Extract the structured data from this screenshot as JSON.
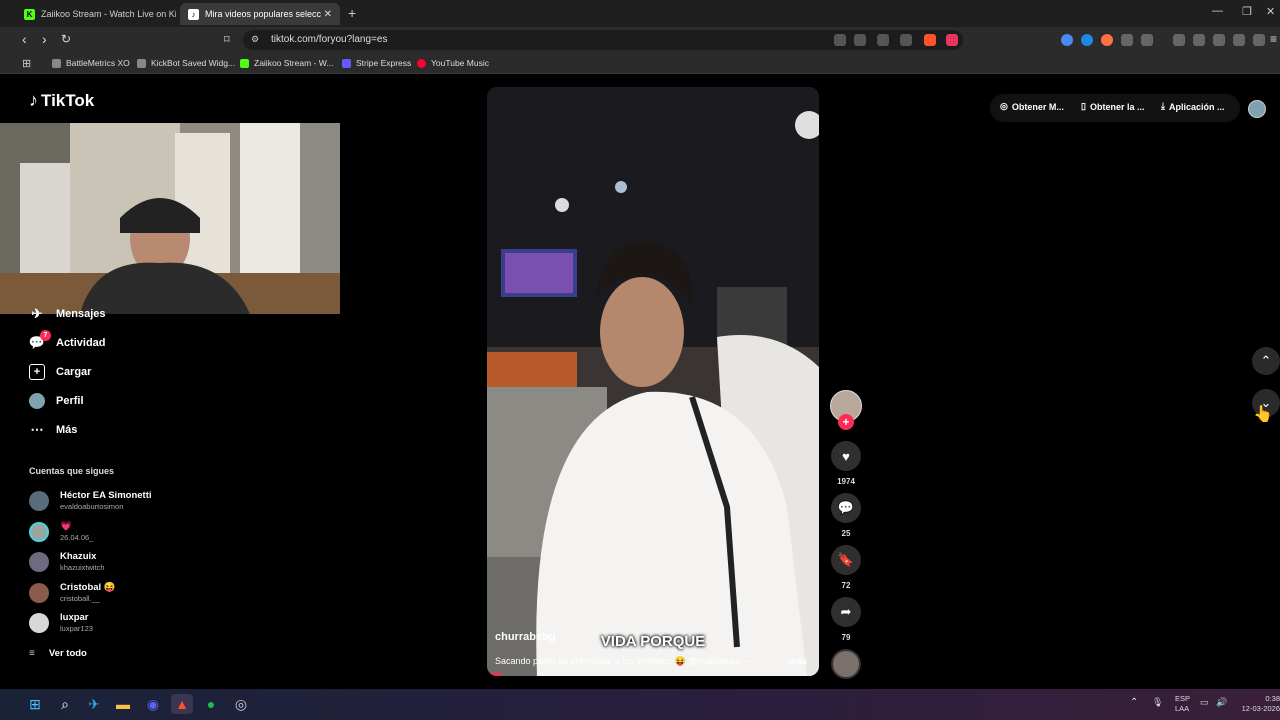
{
  "browser": {
    "tabs": [
      {
        "title": "Zaiikoo Stream - Watch Live on Kick",
        "active": false
      },
      {
        "title": "Mira videos populares selecc",
        "active": true
      }
    ],
    "url": "tiktok.com/foryou?lang=es",
    "bookmarks": [
      {
        "label": "BattleMetrics XO",
        "color": "#888888"
      },
      {
        "label": "KickBot Saved Widg...",
        "color": "#888888"
      },
      {
        "label": "Zaiikoo Stream - W...",
        "color": "#53fc18"
      },
      {
        "label": "Stripe Express",
        "color": "#635bff"
      },
      {
        "label": "YouTube Music",
        "color": "#ff0033"
      }
    ]
  },
  "tiktok": {
    "logo": "TikTok",
    "nav": [
      {
        "label": "Mensajes",
        "icon": "send-icon"
      },
      {
        "label": "Actividad",
        "icon": "activity-icon",
        "badge": "7"
      },
      {
        "label": "Cargar",
        "icon": "upload-icon"
      },
      {
        "label": "Perfil",
        "icon": "profile-icon"
      },
      {
        "label": "Más",
        "icon": "more-icon"
      }
    ],
    "following_title": "Cuentas que sigues",
    "following": [
      {
        "name": "Héctor EA Simonetti",
        "handle": "evaldoaburtosimon",
        "color": "#5a6b7a"
      },
      {
        "name": "💗",
        "handle": "26.04.06_",
        "color": "#9aa7a0"
      },
      {
        "name": "Khazuix",
        "handle": "khazuixtwitch",
        "color": "#6f6a80"
      },
      {
        "name": "Cristobal 😝",
        "handle": "cristoball.__",
        "color": "#8a5a4a"
      },
      {
        "name": "luxpar",
        "handle": "luxpar123",
        "color": "#d8d8d8"
      }
    ],
    "see_all": "Ver todo",
    "header": {
      "items": [
        {
          "label": "Obtener M...",
          "icon": "coin-icon"
        },
        {
          "label": "Obtener la ...",
          "icon": "phone-icon"
        },
        {
          "label": "Aplicación ...",
          "icon": "download-icon"
        }
      ]
    },
    "video": {
      "caption_overlay": "VIDA PORQUE",
      "author": "churrabsbg",
      "description": "Sacando perso pa entrevistar a los invitados 😝 @matijesuss ---",
      "more": "más",
      "likes": "1974",
      "comments": "25",
      "saves": "72",
      "shares": "79"
    }
  },
  "taskbar": {
    "language": "ESP",
    "layout": "LAA",
    "time": "0:38",
    "date": "12-03-2026"
  }
}
